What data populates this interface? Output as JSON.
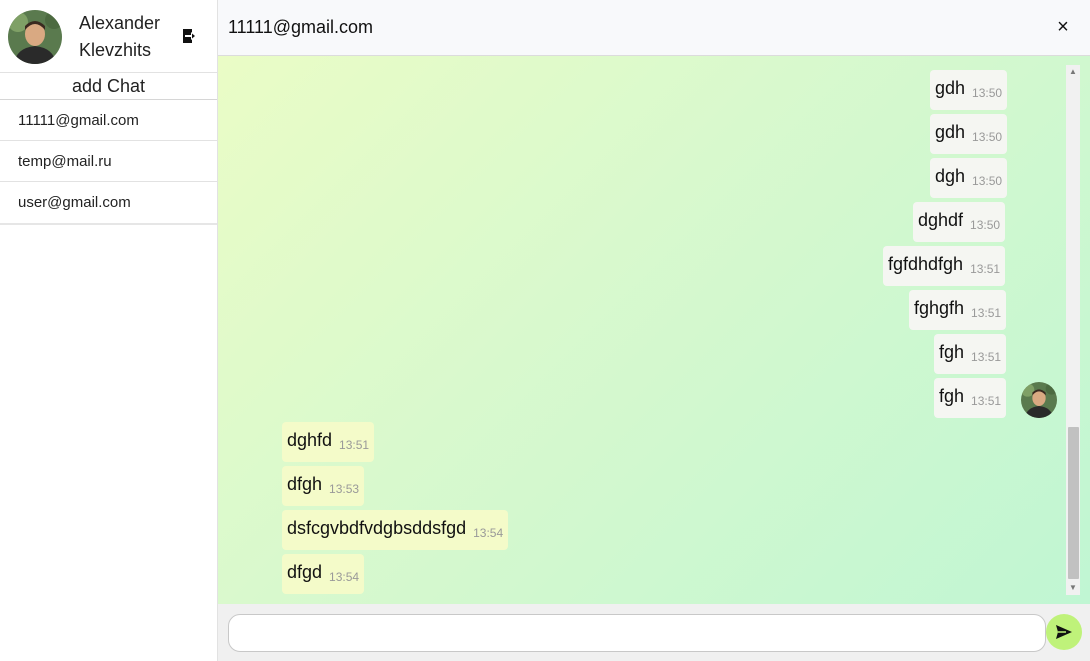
{
  "profile": {
    "name": "Alexander Klevzhits",
    "avatar_icon": "user-photo"
  },
  "sidebar": {
    "add_chat_label": "add Chat",
    "chats": [
      "11111@gmail.com",
      "temp@mail.ru",
      "user@gmail.com"
    ]
  },
  "header": {
    "title": "11111@gmail.com",
    "close_glyph": "×"
  },
  "messages": [
    {
      "text": "gdh",
      "time": "13:50",
      "dir": "out"
    },
    {
      "text": "gdh",
      "time": "13:50",
      "dir": "out"
    },
    {
      "text": "dgh",
      "time": "13:50",
      "dir": "out"
    },
    {
      "text": "dghdf",
      "time": "13:50",
      "dir": "out"
    },
    {
      "text": "fgfdhdfgh",
      "time": "13:51",
      "dir": "out"
    },
    {
      "text": "fghgfh",
      "time": "13:51",
      "dir": "out"
    },
    {
      "text": "fgh",
      "time": "13:51",
      "dir": "out"
    },
    {
      "text": "fgh",
      "time": "13:51",
      "dir": "out"
    },
    {
      "text": "dghfd",
      "time": "13:51",
      "dir": "in"
    },
    {
      "text": "dfgh",
      "time": "13:53",
      "dir": "in"
    },
    {
      "text": "dsfcgvbdfvdgbsddsfgd",
      "time": "13:54",
      "dir": "in"
    },
    {
      "text": "dfgd",
      "time": "13:54",
      "dir": "in"
    }
  ],
  "composer": {
    "value": "",
    "placeholder": ""
  },
  "colors": {
    "accent": "#bff27a",
    "incoming_bubble": "#f4fbc9",
    "outgoing_bubble": "#f5f6f2",
    "chat_bg_start": "#eafcc6",
    "chat_bg_end": "#c0f6d3"
  }
}
